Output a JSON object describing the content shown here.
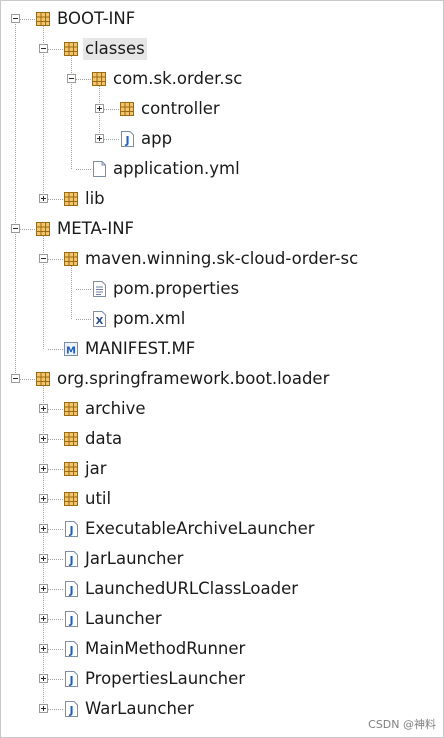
{
  "tree": {
    "items": [
      {
        "label": "BOOT-INF",
        "depth": 0,
        "icon": "package",
        "expander": "minus",
        "selected": false
      },
      {
        "label": "classes",
        "depth": 1,
        "icon": "package",
        "expander": "minus",
        "selected": true
      },
      {
        "label": "com.sk.order.sc",
        "depth": 2,
        "icon": "package",
        "expander": "minus",
        "selected": false
      },
      {
        "label": "controller",
        "depth": 3,
        "icon": "package",
        "expander": "plus",
        "selected": false
      },
      {
        "label": "app",
        "depth": 3,
        "icon": "java-class",
        "expander": "plus",
        "selected": false
      },
      {
        "label": "application.yml",
        "depth": 2,
        "icon": "file",
        "expander": "none",
        "selected": false
      },
      {
        "label": "lib",
        "depth": 1,
        "icon": "package",
        "expander": "plus",
        "selected": false
      },
      {
        "label": "META-INF",
        "depth": 0,
        "icon": "package",
        "expander": "minus",
        "selected": false
      },
      {
        "label": "maven.winning.sk-cloud-order-sc",
        "depth": 1,
        "icon": "package",
        "expander": "minus",
        "selected": false
      },
      {
        "label": "pom.properties",
        "depth": 2,
        "icon": "properties-file",
        "expander": "none",
        "selected": false
      },
      {
        "label": "pom.xml",
        "depth": 2,
        "icon": "xml-file",
        "expander": "none",
        "selected": false
      },
      {
        "label": "MANIFEST.MF",
        "depth": 1,
        "icon": "manifest-file",
        "expander": "none",
        "selected": false
      },
      {
        "label": "org.springframework.boot.loader",
        "depth": 0,
        "icon": "package",
        "expander": "minus",
        "selected": false
      },
      {
        "label": "archive",
        "depth": 1,
        "icon": "package",
        "expander": "plus",
        "selected": false
      },
      {
        "label": "data",
        "depth": 1,
        "icon": "package",
        "expander": "plus",
        "selected": false
      },
      {
        "label": "jar",
        "depth": 1,
        "icon": "package",
        "expander": "plus",
        "selected": false
      },
      {
        "label": "util",
        "depth": 1,
        "icon": "package",
        "expander": "plus",
        "selected": false
      },
      {
        "label": "ExecutableArchiveLauncher",
        "depth": 1,
        "icon": "java-class",
        "expander": "plus",
        "selected": false
      },
      {
        "label": "JarLauncher",
        "depth": 1,
        "icon": "java-class",
        "expander": "plus",
        "selected": false
      },
      {
        "label": "LaunchedURLClassLoader",
        "depth": 1,
        "icon": "java-class",
        "expander": "plus",
        "selected": false
      },
      {
        "label": "Launcher",
        "depth": 1,
        "icon": "java-class",
        "expander": "plus",
        "selected": false
      },
      {
        "label": "MainMethodRunner",
        "depth": 1,
        "icon": "java-class",
        "expander": "plus",
        "selected": false
      },
      {
        "label": "PropertiesLauncher",
        "depth": 1,
        "icon": "java-class",
        "expander": "plus",
        "selected": false
      },
      {
        "label": "WarLauncher",
        "depth": 1,
        "icon": "java-class",
        "expander": "plus",
        "selected": false
      }
    ]
  },
  "watermark": "CSDN @神料",
  "colors": {
    "package": "#b8860b",
    "class_badge": "#1f5fbf",
    "selection": "#e6e6e6"
  }
}
